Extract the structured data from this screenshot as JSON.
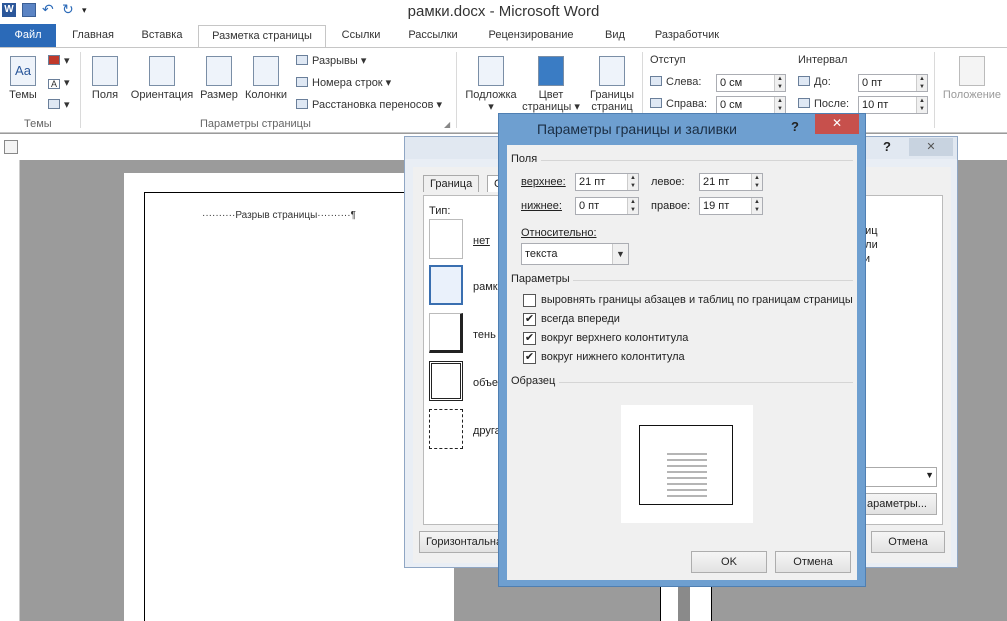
{
  "window": {
    "title": "рамки.docx - Microsoft Word"
  },
  "tabs": [
    "Файл",
    "Главная",
    "Вставка",
    "Разметка страницы",
    "Ссылки",
    "Рассылки",
    "Рецензирование",
    "Вид",
    "Разработчик"
  ],
  "ribbon": {
    "themes": {
      "label": "Темы",
      "group": "Темы"
    },
    "margins": "Поля",
    "orientation": "Ориентация",
    "size": "Размер",
    "columns": "Колонки",
    "breaks": "Разрывы",
    "line_numbers": "Номера строк",
    "hyphenation": "Расстановка переносов",
    "group_page_setup": "Параметры страницы",
    "watermark": "Подложка",
    "page_color": "Цвет страницы",
    "page_borders": "Границы страниц",
    "indent": {
      "title": "Отступ",
      "left_label": "Слева:",
      "left_value": "0 см",
      "right_label": "Справа:",
      "right_value": "0 см"
    },
    "spacing": {
      "title": "Интервал",
      "before_label": "До:",
      "before_value": "0 пт",
      "after_label": "После:",
      "after_value": "10 пт"
    },
    "position": "Положение"
  },
  "document": {
    "page_break": "Разрыв страницы"
  },
  "back_dialog": {
    "tab_border": "Граница",
    "tab_page": "Ст",
    "type_label": "Тип:",
    "types": [
      "нет",
      "рамка",
      "тень",
      "объем",
      "другая"
    ],
    "right_text": [
      "ниц",
      "или",
      "ки"
    ],
    "options_button": "араметры...",
    "horizontal_button": "Горизонтальна",
    "cancel_button": "Отмена"
  },
  "dialog": {
    "title": "Параметры границы и заливки",
    "help": "?",
    "close": "✕",
    "fields_section": "Поля",
    "top_label": "верхнее:",
    "top_value": "21 пт",
    "left_label": "левое:",
    "left_value": "21 пт",
    "bottom_label": "нижнее:",
    "bottom_value": "0 пт",
    "right_label": "правое:",
    "right_value": "19 пт",
    "relative_label": "Относительно:",
    "relative_value": "текста",
    "params_section": "Параметры",
    "options": [
      {
        "label": "выровнять границы абзацев и таблиц по границам страницы",
        "checked": false
      },
      {
        "label": "всегда впереди",
        "checked": true
      },
      {
        "label": "вокруг верхнего колонтитула",
        "checked": true
      },
      {
        "label": "вокруг нижнего колонтитула",
        "checked": true
      }
    ],
    "sample_section": "Образец",
    "ok_button": "OK",
    "cancel_button": "Отмена"
  }
}
